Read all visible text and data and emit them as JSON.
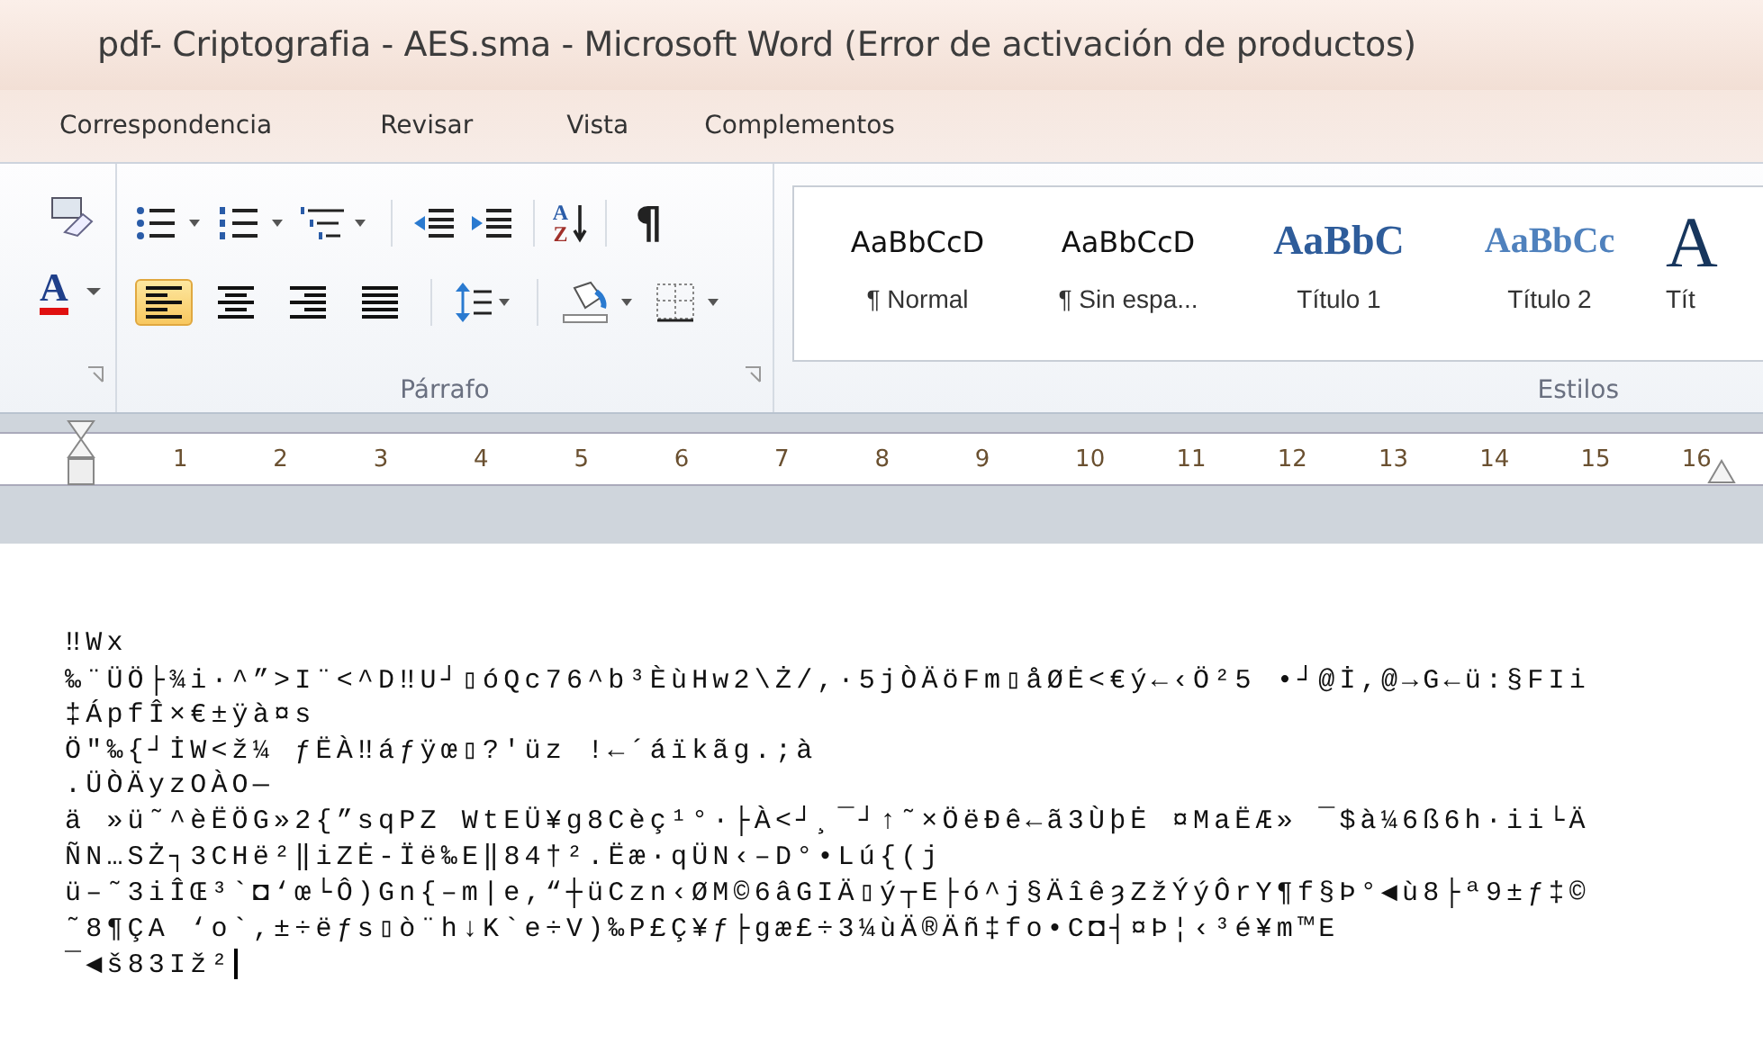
{
  "window": {
    "title": "pdf- Criptografia - AES.sma - Microsoft Word (Error de activación de productos)"
  },
  "menu_tabs": [
    {
      "label": "Correspondencia"
    },
    {
      "label": "Revisar"
    },
    {
      "label": "Vista"
    },
    {
      "label": "Complementos"
    }
  ],
  "ribbon": {
    "font_group": {
      "font_color_glyph": "A"
    },
    "paragraph_group": {
      "label": "Párrafo",
      "sort_glyphs": [
        "A",
        "Z"
      ],
      "show_marks_glyph": "¶",
      "alignment_buttons": [
        {
          "kind": "left",
          "selected": true
        },
        {
          "kind": "center",
          "selected": false
        },
        {
          "kind": "right",
          "selected": false
        },
        {
          "kind": "justify",
          "selected": false
        }
      ]
    },
    "styles_group": {
      "label": "Estilos",
      "styles": [
        {
          "kind": "normal",
          "sample": "AaBbCcD",
          "label": "¶ Normal"
        },
        {
          "kind": "normal",
          "sample": "AaBbCcD",
          "label": "¶ Sin espa..."
        },
        {
          "kind": "heading1",
          "sample": "AaBbC",
          "label": "Título 1"
        },
        {
          "kind": "heading2",
          "sample": "AaBbCc",
          "label": "Título 2"
        },
        {
          "kind": "title",
          "sample": "A",
          "label": "Tít"
        }
      ]
    }
  },
  "ruler": {
    "numbers": [
      "1",
      "2",
      "3",
      "4",
      "5",
      "6",
      "7",
      "8",
      "9",
      "10",
      "11",
      "12",
      "13",
      "14",
      "15",
      "16"
    ]
  },
  "document": {
    "lines": [
      "‼Wx",
      "‰¨ÜÖ├¾i·^”>I¨<^D‼U┘▯óQc76^b³ÈùHw2\\Ż/,·5jÒÄöFm▯åØĖ<€ý←‹Ö²5 •┘@İ,@→G←ü:§FIi",
      "‡ÁpfÎ×€±ÿà¤s",
      "Ö\"‰{┘İW<ž¼ ƒËÀ‼áƒÿœ▯?′üz !←´áïkãg.;à",
      ".ÜÒÄyzOÀO—",
      "ä »ü˜^èËÖG»2{”sqPZ WtEÜ¥g8Cèç¹°·├À<┘¸¯┘↑˜×ÖëÐê←ã3ÙþĖ ¤MaËÆ» ¯$à¼6ß6h·ii└Ä",
      "ÑN…SŻ┐3CHë²‖iZĖ-Ïë‰E‖84†².Ëæ·qÜN‹–D°•Lú{(j",
      "ü–˜3iÎŒ³`◘‘œ└Ô)Gn{–m|e,“┼üCzn‹ØM©6âGIÄ▯ý┬E├ó^j§ÄîêȝZžÝýÔrY¶f§Þ°◀ù8├ª9±ƒ‡©",
      "˜8¶ÇA ‘o`,±÷ëƒs▯ò¨h↓K`e÷V)‰P£Ç¥ƒ├gæ£÷3¼ùÄ®Äñ‡fo•C◘┤¤Þ¦‹³é¥m™E",
      "¯◀š83Iž²"
    ]
  }
}
